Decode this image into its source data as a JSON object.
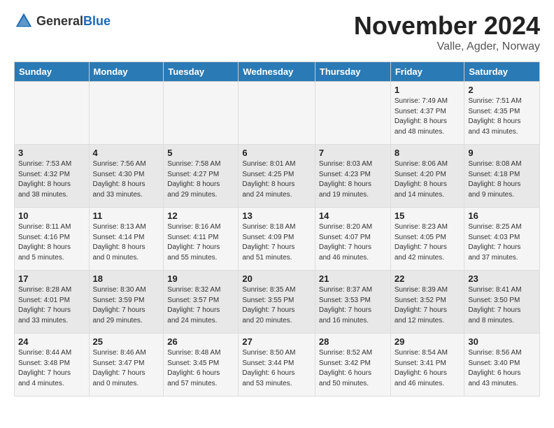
{
  "header": {
    "logo_general": "General",
    "logo_blue": "Blue",
    "title": "November 2024",
    "location": "Valle, Agder, Norway"
  },
  "columns": [
    "Sunday",
    "Monday",
    "Tuesday",
    "Wednesday",
    "Thursday",
    "Friday",
    "Saturday"
  ],
  "weeks": [
    [
      {
        "day": "",
        "info": ""
      },
      {
        "day": "",
        "info": ""
      },
      {
        "day": "",
        "info": ""
      },
      {
        "day": "",
        "info": ""
      },
      {
        "day": "",
        "info": ""
      },
      {
        "day": "1",
        "info": "Sunrise: 7:49 AM\nSunset: 4:37 PM\nDaylight: 8 hours\nand 48 minutes."
      },
      {
        "day": "2",
        "info": "Sunrise: 7:51 AM\nSunset: 4:35 PM\nDaylight: 8 hours\nand 43 minutes."
      }
    ],
    [
      {
        "day": "3",
        "info": "Sunrise: 7:53 AM\nSunset: 4:32 PM\nDaylight: 8 hours\nand 38 minutes."
      },
      {
        "day": "4",
        "info": "Sunrise: 7:56 AM\nSunset: 4:30 PM\nDaylight: 8 hours\nand 33 minutes."
      },
      {
        "day": "5",
        "info": "Sunrise: 7:58 AM\nSunset: 4:27 PM\nDaylight: 8 hours\nand 29 minutes."
      },
      {
        "day": "6",
        "info": "Sunrise: 8:01 AM\nSunset: 4:25 PM\nDaylight: 8 hours\nand 24 minutes."
      },
      {
        "day": "7",
        "info": "Sunrise: 8:03 AM\nSunset: 4:23 PM\nDaylight: 8 hours\nand 19 minutes."
      },
      {
        "day": "8",
        "info": "Sunrise: 8:06 AM\nSunset: 4:20 PM\nDaylight: 8 hours\nand 14 minutes."
      },
      {
        "day": "9",
        "info": "Sunrise: 8:08 AM\nSunset: 4:18 PM\nDaylight: 8 hours\nand 9 minutes."
      }
    ],
    [
      {
        "day": "10",
        "info": "Sunrise: 8:11 AM\nSunset: 4:16 PM\nDaylight: 8 hours\nand 5 minutes."
      },
      {
        "day": "11",
        "info": "Sunrise: 8:13 AM\nSunset: 4:14 PM\nDaylight: 8 hours\nand 0 minutes."
      },
      {
        "day": "12",
        "info": "Sunrise: 8:16 AM\nSunset: 4:11 PM\nDaylight: 7 hours\nand 55 minutes."
      },
      {
        "day": "13",
        "info": "Sunrise: 8:18 AM\nSunset: 4:09 PM\nDaylight: 7 hours\nand 51 minutes."
      },
      {
        "day": "14",
        "info": "Sunrise: 8:20 AM\nSunset: 4:07 PM\nDaylight: 7 hours\nand 46 minutes."
      },
      {
        "day": "15",
        "info": "Sunrise: 8:23 AM\nSunset: 4:05 PM\nDaylight: 7 hours\nand 42 minutes."
      },
      {
        "day": "16",
        "info": "Sunrise: 8:25 AM\nSunset: 4:03 PM\nDaylight: 7 hours\nand 37 minutes."
      }
    ],
    [
      {
        "day": "17",
        "info": "Sunrise: 8:28 AM\nSunset: 4:01 PM\nDaylight: 7 hours\nand 33 minutes."
      },
      {
        "day": "18",
        "info": "Sunrise: 8:30 AM\nSunset: 3:59 PM\nDaylight: 7 hours\nand 29 minutes."
      },
      {
        "day": "19",
        "info": "Sunrise: 8:32 AM\nSunset: 3:57 PM\nDaylight: 7 hours\nand 24 minutes."
      },
      {
        "day": "20",
        "info": "Sunrise: 8:35 AM\nSunset: 3:55 PM\nDaylight: 7 hours\nand 20 minutes."
      },
      {
        "day": "21",
        "info": "Sunrise: 8:37 AM\nSunset: 3:53 PM\nDaylight: 7 hours\nand 16 minutes."
      },
      {
        "day": "22",
        "info": "Sunrise: 8:39 AM\nSunset: 3:52 PM\nDaylight: 7 hours\nand 12 minutes."
      },
      {
        "day": "23",
        "info": "Sunrise: 8:41 AM\nSunset: 3:50 PM\nDaylight: 7 hours\nand 8 minutes."
      }
    ],
    [
      {
        "day": "24",
        "info": "Sunrise: 8:44 AM\nSunset: 3:48 PM\nDaylight: 7 hours\nand 4 minutes."
      },
      {
        "day": "25",
        "info": "Sunrise: 8:46 AM\nSunset: 3:47 PM\nDaylight: 7 hours\nand 0 minutes."
      },
      {
        "day": "26",
        "info": "Sunrise: 8:48 AM\nSunset: 3:45 PM\nDaylight: 6 hours\nand 57 minutes."
      },
      {
        "day": "27",
        "info": "Sunrise: 8:50 AM\nSunset: 3:44 PM\nDaylight: 6 hours\nand 53 minutes."
      },
      {
        "day": "28",
        "info": "Sunrise: 8:52 AM\nSunset: 3:42 PM\nDaylight: 6 hours\nand 50 minutes."
      },
      {
        "day": "29",
        "info": "Sunrise: 8:54 AM\nSunset: 3:41 PM\nDaylight: 6 hours\nand 46 minutes."
      },
      {
        "day": "30",
        "info": "Sunrise: 8:56 AM\nSunset: 3:40 PM\nDaylight: 6 hours\nand 43 minutes."
      }
    ]
  ]
}
